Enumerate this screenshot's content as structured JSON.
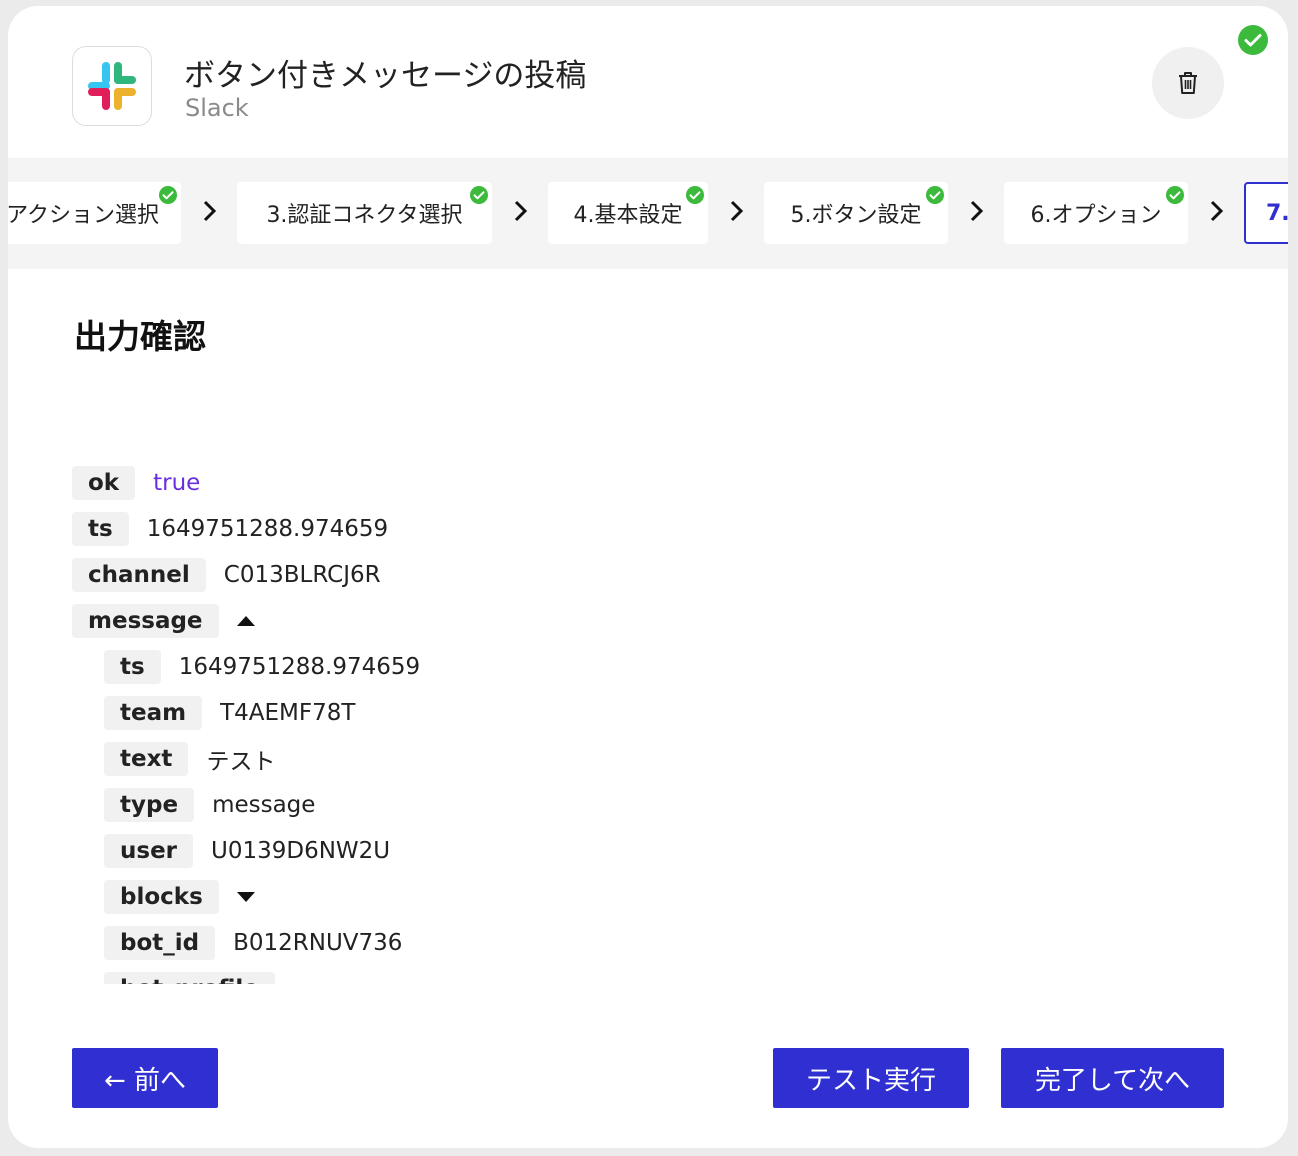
{
  "header": {
    "title": "ボタン付きメッセージの投稿",
    "service": "Slack",
    "app_icon": "slack-logo",
    "delete_icon": "trash-icon",
    "status_icon": "check-circle-icon"
  },
  "steps": [
    {
      "label": "アクション選択",
      "done": true
    },
    {
      "label": "3.認証コネクタ選択",
      "done": true
    },
    {
      "label": "4.基本設定",
      "done": true
    },
    {
      "label": "5.ボタン設定",
      "done": true
    },
    {
      "label": "6.オプション",
      "done": true
    },
    {
      "label": "7.",
      "done": false,
      "active": true
    }
  ],
  "section_title": "出力確認",
  "output": {
    "ok": {
      "key": "ok",
      "value": "true"
    },
    "ts": {
      "key": "ts",
      "value": "1649751288.974659"
    },
    "channel": {
      "key": "channel",
      "value": "C013BLRCJ6R"
    },
    "message": {
      "key": "message",
      "expanded": true
    },
    "message_ts": {
      "key": "ts",
      "value": "1649751288.974659"
    },
    "message_team": {
      "key": "team",
      "value": "T4AEMF78T"
    },
    "message_text": {
      "key": "text",
      "value": "テスト"
    },
    "message_type": {
      "key": "type",
      "value": "message"
    },
    "message_user": {
      "key": "user",
      "value": "U0139D6NW2U"
    },
    "message_blocks": {
      "key": "blocks",
      "expanded": false
    },
    "message_bot_id": {
      "key": "bot_id",
      "value": "B012RNUV736"
    },
    "message_bot_profile": {
      "key": "bot_profile",
      "expanded": false
    }
  },
  "buttons": {
    "prev": "← 前へ",
    "test": "テスト実行",
    "next": "完了して次へ"
  },
  "colors": {
    "primary": "#2f2fd2",
    "success": "#3cba3c",
    "bool_value": "#6a2ee0"
  }
}
